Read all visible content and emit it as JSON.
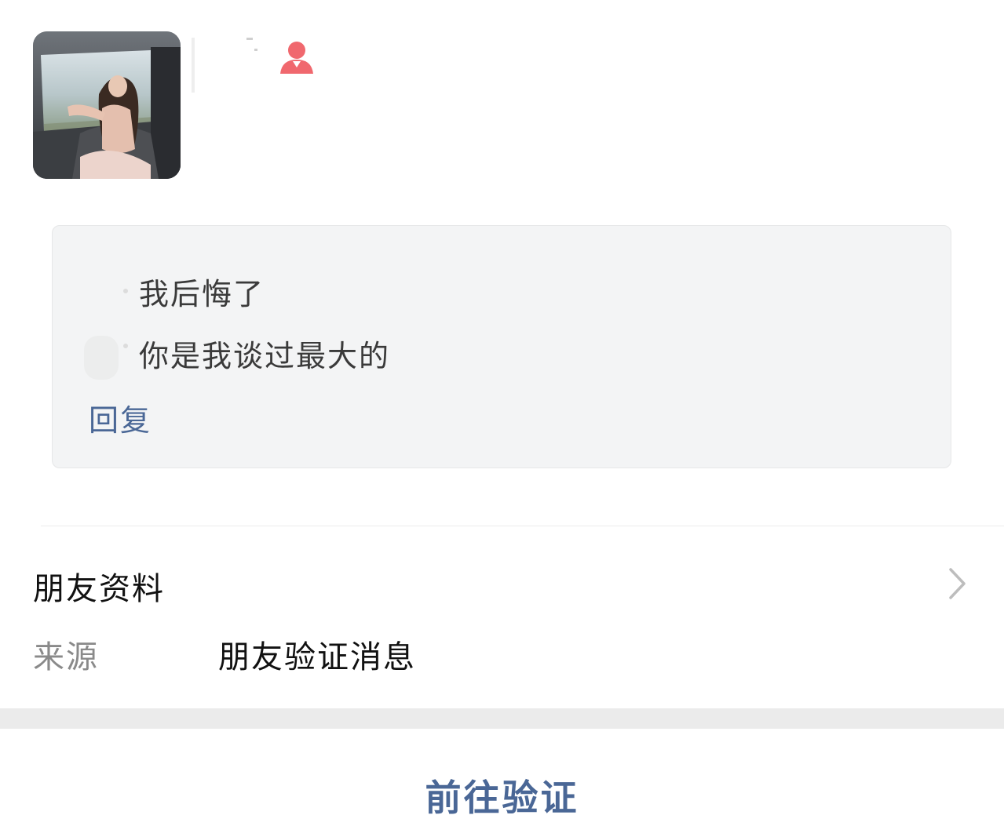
{
  "contact": {
    "avatar_icon": "profile-photo",
    "gender_icon": "female-user-icon",
    "gender_color": "#f0686e"
  },
  "message": {
    "lines": [
      "我后悔了",
      "你是我谈过最大的"
    ],
    "reply_label": "回复"
  },
  "profile": {
    "title": "朋友资料",
    "chevron_icon": "chevron-right-icon",
    "source_label": "来源",
    "source_value": "朋友验证消息"
  },
  "action": {
    "verify_label": "前往验证"
  },
  "colors": {
    "link": "#4a6796",
    "card_bg": "#f3f4f5",
    "section_gap": "#ebebeb"
  }
}
